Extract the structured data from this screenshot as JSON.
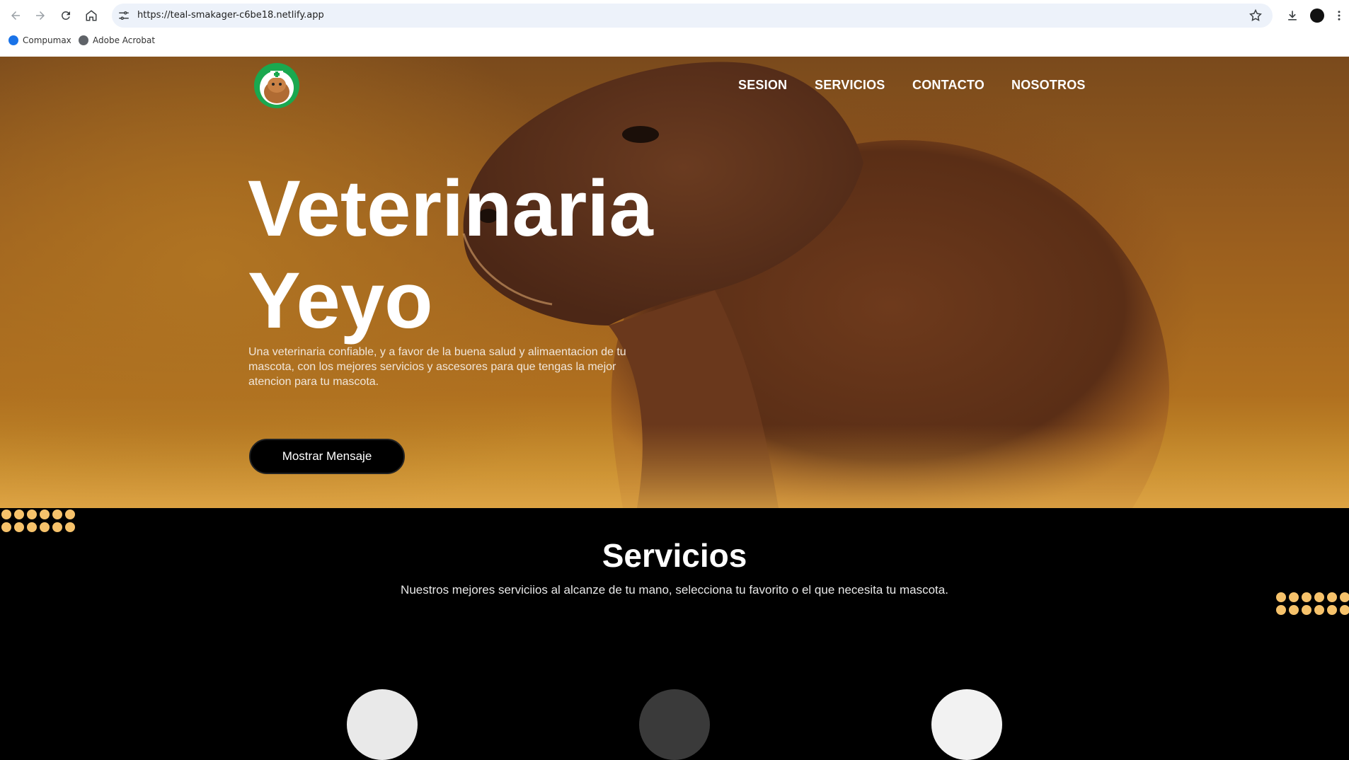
{
  "browser": {
    "url": "https://teal-smakager-c6be18.netlify.app",
    "bookmarks": [
      {
        "label": "Compumax",
        "icon": "compumax-icon",
        "color": "#1a73e8"
      },
      {
        "label": "Adobe Acrobat",
        "icon": "globe-icon",
        "color": "#5f6368"
      }
    ]
  },
  "site": {
    "nav": [
      "SESION",
      "SERVICIOS",
      "CONTACTO",
      "NOSOTROS"
    ],
    "hero": {
      "title_line1": "Veterinaria",
      "title_line2": "Yeyo",
      "description": "Una veterinaria confiable, y a favor de la buena salud y alimaentacion de tu mascota, con los mejores servicios y ascesores para que tengas la mejor atencion para tu mascota.",
      "button_label": "Mostrar Mensaje"
    },
    "services": {
      "title": "Servicios",
      "subtitle": "Nuestros mejores serviciios al alcanze de tu mano, selecciona tu favorito o el que necesita tu mascota."
    }
  },
  "colors": {
    "accent_dots": "#f6c26b",
    "logo_green": "#1aa84f"
  }
}
